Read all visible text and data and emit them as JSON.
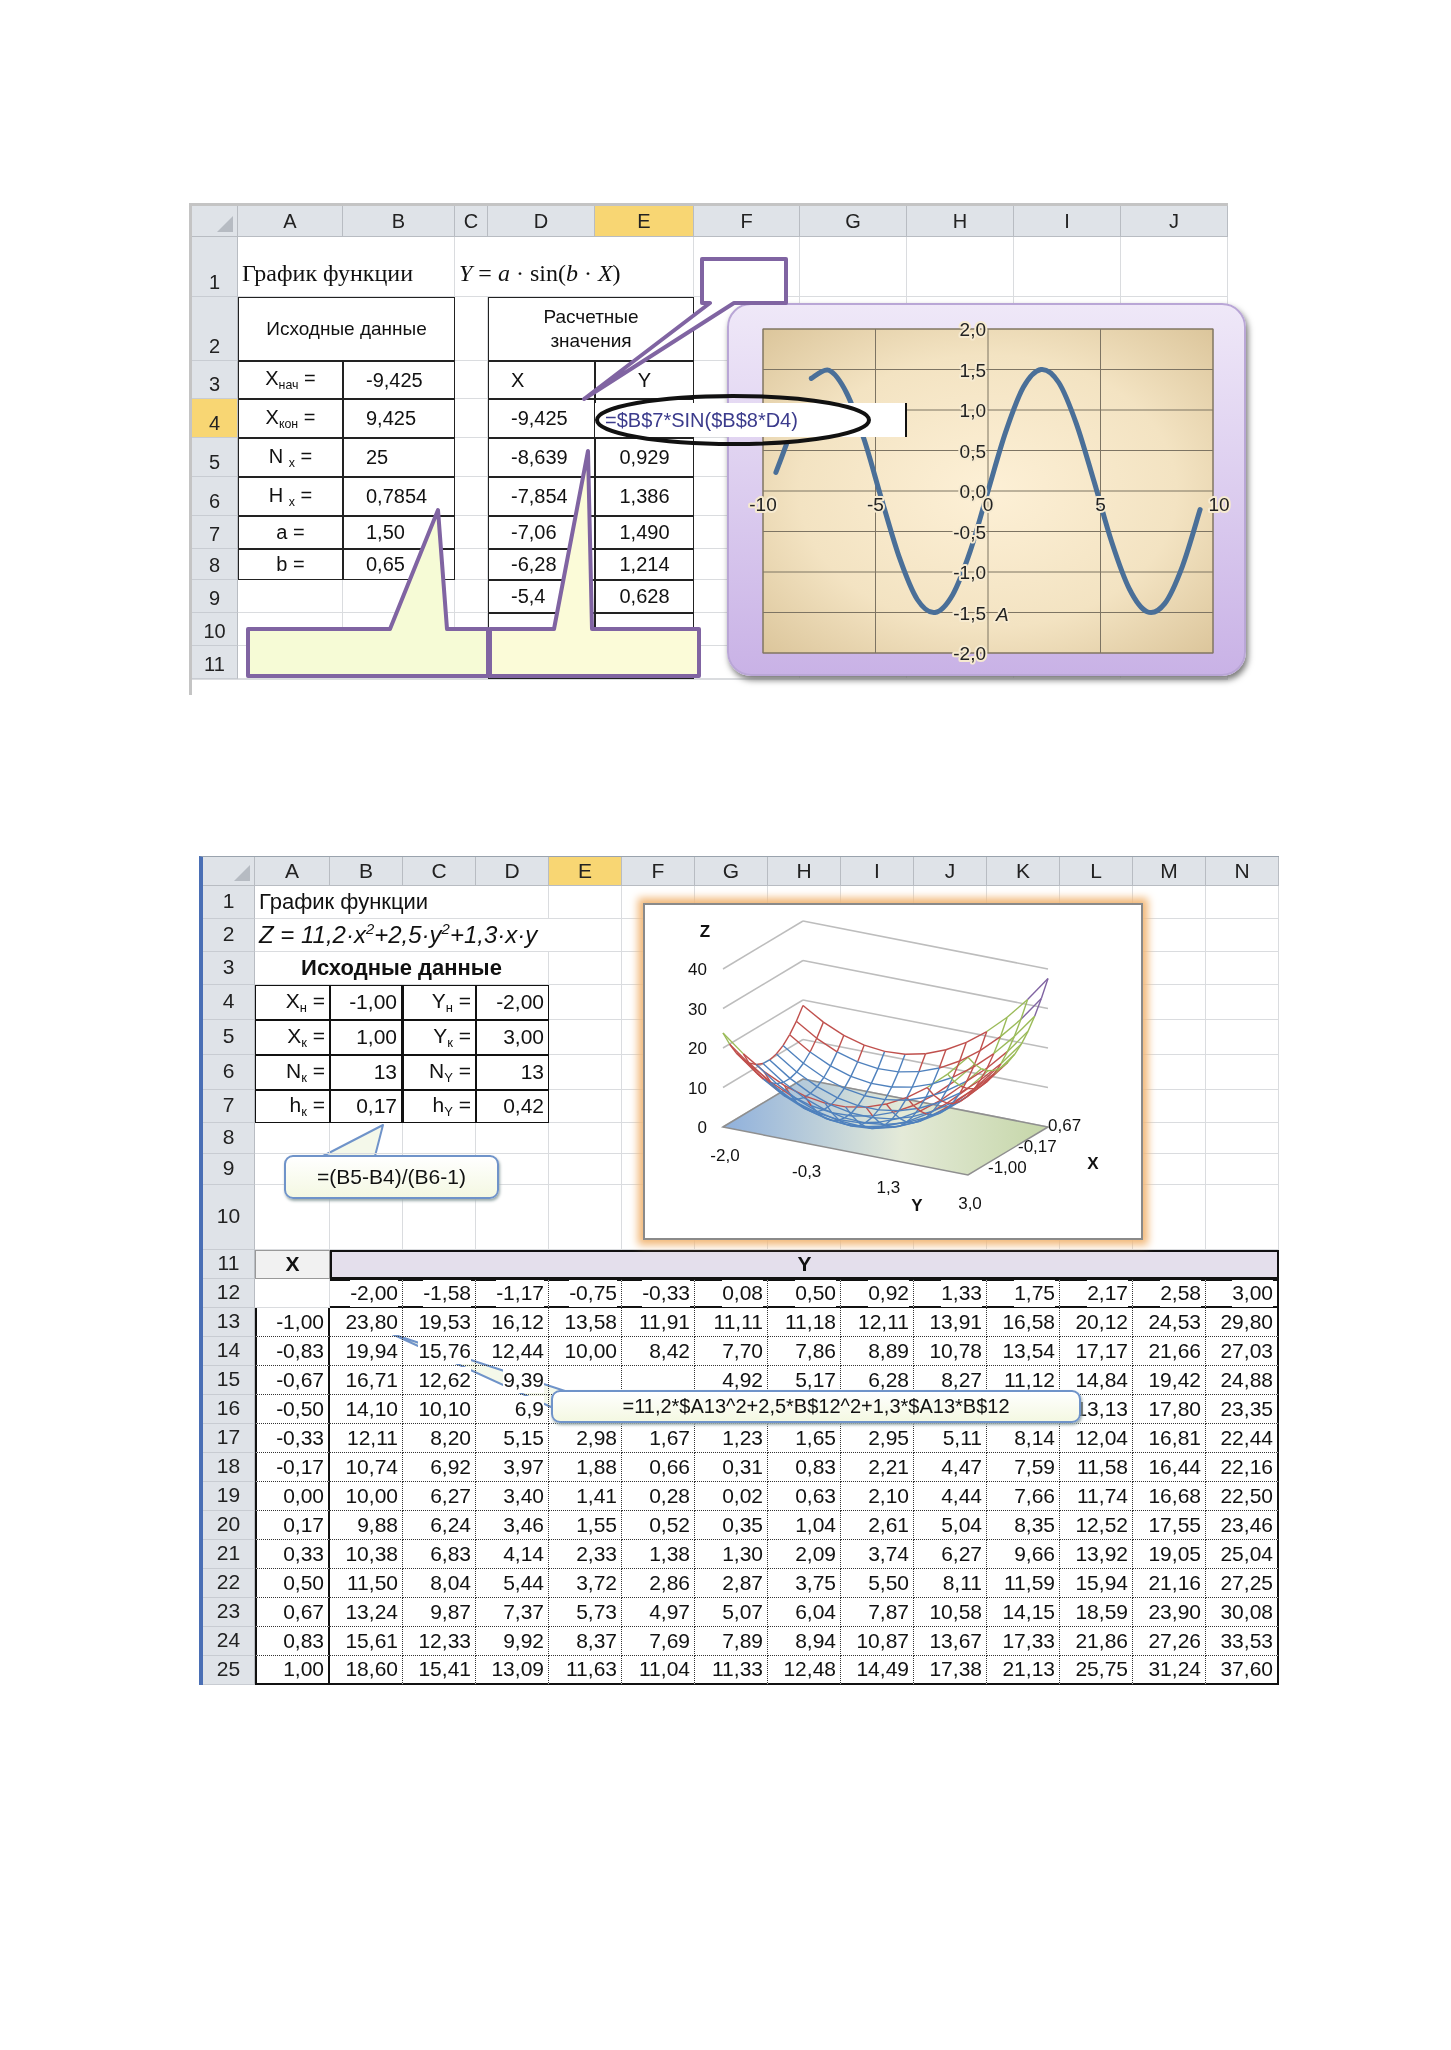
{
  "top_sheet": {
    "columns": [
      {
        "label": "A",
        "selected": false
      },
      {
        "label": "B",
        "selected": false
      },
      {
        "label": "C",
        "selected": false
      },
      {
        "label": "D",
        "selected": false
      },
      {
        "label": "E",
        "selected": true
      },
      {
        "label": "F",
        "selected": false
      },
      {
        "label": "G",
        "selected": false
      },
      {
        "label": "H",
        "selected": false
      },
      {
        "label": "I",
        "selected": false
      },
      {
        "label": "J",
        "selected": false
      }
    ],
    "rows": [
      {
        "number": "1",
        "selected": false,
        "kind": "title",
        "cells": [
          "График функции",
          "*Y* = *a* · sin(*b* · *X*)"
        ]
      },
      {
        "number": "2",
        "selected": false,
        "kind": "caption",
        "cells": [
          "Исходные данные",
          null,
          "Расчетные значения"
        ]
      },
      {
        "number": "3",
        "selected": false,
        "kind": "data",
        "cells": [
          "X$_{нач}$ =",
          "-9,425",
          null,
          "X",
          "Y"
        ]
      },
      {
        "number": "4",
        "selected": true,
        "kind": "data",
        "cells": [
          "X$_{кон}$ =",
          "9,425",
          null,
          "-9,425"
        ]
      },
      {
        "number": "5",
        "selected": false,
        "kind": "data",
        "cells": [
          "N $_{x}$ =",
          "25",
          null,
          "-8,639",
          "0,929"
        ]
      },
      {
        "number": "6",
        "selected": false,
        "kind": "data",
        "cells": [
          "H $_{x}$ =",
          "0,7854",
          null,
          "-7,854",
          "1,386"
        ]
      },
      {
        "number": "7",
        "selected": false,
        "kind": "data",
        "cells": [
          "a =",
          "1,50",
          null,
          "-7,06",
          "1,490"
        ]
      },
      {
        "number": "8",
        "selected": false,
        "kind": "data",
        "cells": [
          "b =",
          "0,65",
          null,
          "-6,28",
          "1,214"
        ]
      },
      {
        "number": "9",
        "selected": false,
        "kind": "data",
        "cells": [
          null,
          null,
          null,
          "-5,4",
          "0,628"
        ]
      },
      {
        "number": "10",
        "selected": false,
        "kind": "data"
      },
      {
        "number": "11",
        "selected": false,
        "kind": "data"
      }
    ],
    "formula_input": {
      "value": "=$B$7*SIN($B$8*D4)"
    },
    "chart": {
      "chart_data": {
        "type": "line",
        "x": [
          -9.425,
          -8.639,
          -7.854,
          -7.069,
          -6.283,
          -5.498,
          -4.712,
          -3.927,
          -3.142,
          -2.356,
          -1.571,
          -0.785,
          0,
          0.785,
          1.571,
          2.356,
          3.142,
          3.927,
          4.712,
          5.498,
          6.283,
          7.069,
          7.854,
          8.639,
          9.425
        ],
        "values": [
          0.23,
          null,
          1.39,
          1.49,
          1.21,
          0.63,
          -0.12,
          -0.83,
          -1.34,
          -1.5,
          -1.28,
          -0.74,
          0,
          0.73,
          1.28,
          1.5,
          1.34,
          0.83,
          0.12,
          -0.63,
          -1.21,
          -1.49,
          -1.39,
          -0.93,
          -0.23
        ],
        "grid": true,
        "xlim": [
          -10,
          10
        ],
        "ylim": [
          -2,
          2
        ],
        "xticks": [
          -10,
          -5,
          0,
          5,
          10
        ],
        "yticks": [
          {
            "value": 2,
            "label": "2,0"
          },
          {
            "value": 1.5,
            "label": "1,5"
          },
          {
            "value": 1,
            "label": "1,0"
          },
          {
            "value": 0.5,
            "label": "0,5"
          },
          {
            "value": 0,
            "label": "0,0"
          },
          {
            "value": -0.5,
            "label": "-0,5"
          },
          {
            "value": -1,
            "label": "-1,0"
          },
          {
            "value": -1.5,
            "label": "-1,5"
          },
          {
            "value": -2,
            "label": "-2,0"
          }
        ],
        "annotations": [
          "A"
        ]
      }
    }
  },
  "bottom_sheet": {
    "columns": [
      {
        "label": "A",
        "selected": false
      },
      {
        "label": "B",
        "selected": false
      },
      {
        "label": "C",
        "selected": false
      },
      {
        "label": "D",
        "selected": false
      },
      {
        "label": "E",
        "selected": true
      },
      {
        "label": "F",
        "selected": false
      },
      {
        "label": "G",
        "selected": false
      },
      {
        "label": "H",
        "selected": false
      },
      {
        "label": "I",
        "selected": false
      },
      {
        "label": "J",
        "selected": false
      },
      {
        "label": "K",
        "selected": false
      },
      {
        "label": "L",
        "selected": false
      },
      {
        "label": "M",
        "selected": false
      },
      {
        "label": "N",
        "selected": false
      }
    ],
    "rows": [
      {
        "number": "1",
        "selected": false,
        "kind": "title",
        "cells": [
          "График функции"
        ]
      },
      {
        "number": "2",
        "selected": false,
        "kind": "formula",
        "cells": [
          "Z = 11,2·x$^{2}$+2,5·y$^{2}$+1,3·x·y"
        ]
      },
      {
        "number": "3",
        "selected": false,
        "kind": "heading",
        "cells": [
          "Исходные данные"
        ]
      },
      {
        "number": "4",
        "selected": false,
        "kind": "data",
        "cells": [
          "X$_{н}$ =",
          "-1,00",
          "Y$_{н}$ =",
          "-2,00"
        ]
      },
      {
        "number": "5",
        "selected": false,
        "kind": "data",
        "cells": [
          "X$_{к}$ =",
          "1,00",
          "Y$_{к}$ =",
          "3,00"
        ]
      },
      {
        "number": "6",
        "selected": false,
        "kind": "data",
        "cells": [
          "N$_{к}$ =",
          "13",
          "N$_{Y}$ =",
          "13"
        ]
      },
      {
        "number": "7",
        "selected": false,
        "kind": "data",
        "cells": [
          "h$_{к}$ =",
          "0,17",
          "h$_{Y}$ =",
          "0,42"
        ]
      },
      {
        "number": "8",
        "selected": false,
        "kind": "data"
      },
      {
        "number": "9",
        "selected": false,
        "kind": "data"
      },
      {
        "number": "10",
        "selected": false,
        "kind": "data"
      },
      {
        "number": "11",
        "selected": false,
        "kind": "header",
        "cells": [
          "X",
          "Y"
        ]
      },
      {
        "number": "12",
        "selected": false,
        "kind": "data",
        "cells": [
          null,
          "-2,00",
          "-1,58",
          "-1,17",
          "-0,75",
          "-0,33",
          "0,08",
          "0,50",
          "0,92",
          "1,33",
          "1,75",
          "2,17",
          "2,58",
          "3,00"
        ]
      },
      {
        "number": "13",
        "selected": false,
        "kind": "data",
        "cells": [
          "-1,00",
          "23,80",
          "19,53",
          "16,12",
          "13,58",
          "11,91",
          "11,11",
          "11,18",
          "12,11",
          "13,91",
          "16,58",
          "20,12",
          "24,53",
          "29,80"
        ]
      },
      {
        "number": "14",
        "selected": false,
        "kind": "data",
        "cells": [
          "-0,83",
          "19,94",
          "15,76",
          "12,44",
          "10,00",
          "8,42",
          "7,70",
          "7,86",
          "8,89",
          "10,78",
          "13,54",
          "17,17",
          "21,66",
          "27,03"
        ]
      },
      {
        "number": "15",
        "selected": false,
        "kind": "data",
        "cells": [
          "-0,67",
          "16,71",
          "12,62",
          "9,39",
          null,
          null,
          "4,92",
          "5,17",
          "6,28",
          "8,27",
          "11,12",
          "14,84",
          "19,42",
          "24,88"
        ]
      },
      {
        "number": "16",
        "selected": false,
        "kind": "data",
        "cells": [
          "-0,50",
          "14,10",
          "10,10",
          "6,9",
          null,
          null,
          null,
          null,
          null,
          null,
          null,
          "13,13",
          "17,80",
          "23,35"
        ]
      },
      {
        "number": "17",
        "selected": false,
        "kind": "data",
        "cells": [
          "-0,33",
          "12,11",
          "8,20",
          "5,15",
          "2,98",
          "1,67",
          "1,23",
          "1,65",
          "2,95",
          "5,11",
          "8,14",
          "12,04",
          "16,81",
          "22,44"
        ]
      },
      {
        "number": "18",
        "selected": false,
        "kind": "data",
        "cells": [
          "-0,17",
          "10,74",
          "6,92",
          "3,97",
          "1,88",
          "0,66",
          "0,31",
          "0,83",
          "2,21",
          "4,47",
          "7,59",
          "11,58",
          "16,44",
          "22,16"
        ]
      },
      {
        "number": "19",
        "selected": false,
        "kind": "data",
        "cells": [
          "0,00",
          "10,00",
          "6,27",
          "3,40",
          "1,41",
          "0,28",
          "0,02",
          "0,63",
          "2,10",
          "4,44",
          "7,66",
          "11,74",
          "16,68",
          "22,50"
        ]
      },
      {
        "number": "20",
        "selected": false,
        "kind": "data",
        "cells": [
          "0,17",
          "9,88",
          "6,24",
          "3,46",
          "1,55",
          "0,52",
          "0,35",
          "1,04",
          "2,61",
          "5,04",
          "8,35",
          "12,52",
          "17,55",
          "23,46"
        ]
      },
      {
        "number": "21",
        "selected": false,
        "kind": "data",
        "cells": [
          "0,33",
          "10,38",
          "6,83",
          "4,14",
          "2,33",
          "1,38",
          "1,30",
          "2,09",
          "3,74",
          "6,27",
          "9,66",
          "13,92",
          "19,05",
          "25,04"
        ]
      },
      {
        "number": "22",
        "selected": false,
        "kind": "data",
        "cells": [
          "0,50",
          "11,50",
          "8,04",
          "5,44",
          "3,72",
          "2,86",
          "2,87",
          "3,75",
          "5,50",
          "8,11",
          "11,59",
          "15,94",
          "21,16",
          "27,25"
        ]
      },
      {
        "number": "23",
        "selected": false,
        "kind": "data",
        "cells": [
          "0,67",
          "13,24",
          "9,87",
          "7,37",
          "5,73",
          "4,97",
          "5,07",
          "6,04",
          "7,87",
          "10,58",
          "14,15",
          "18,59",
          "23,90",
          "30,08"
        ]
      },
      {
        "number": "24",
        "selected": false,
        "kind": "data",
        "cells": [
          "0,83",
          "15,61",
          "12,33",
          "9,92",
          "8,37",
          "7,69",
          "7,89",
          "8,94",
          "10,87",
          "13,67",
          "17,33",
          "21,86",
          "27,26",
          "33,53"
        ]
      },
      {
        "number": "25",
        "selected": false,
        "kind": "data",
        "cells": [
          "1,00",
          "18,60",
          "15,41",
          "13,09",
          "11,63",
          "11,04",
          "11,33",
          "12,48",
          "14,49",
          "17,38",
          "21,13",
          "25,75",
          "31,24",
          "37,60"
        ]
      }
    ],
    "callouts": [
      {
        "text": "=(B5-B4)/(B6-1)"
      },
      {
        "text": "=11,2*$A13^2+2,5*B$12^2+1,3*$A13*B$12"
      }
    ],
    "surface_chart": {
      "z_title": "Z",
      "z_ticks": [
        "40",
        "30",
        "20",
        "10",
        "0"
      ],
      "y_ticks": [
        "-2,0",
        "-0,3",
        "1,3",
        "3,0"
      ],
      "y_title": "Y",
      "x_ticks": [
        "-1,00",
        "-0,17",
        "0,67"
      ],
      "x_title": "X"
    }
  }
}
